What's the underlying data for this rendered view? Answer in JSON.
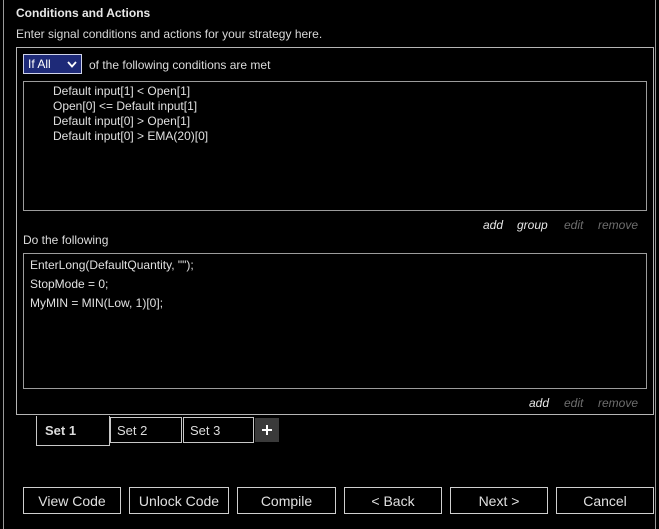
{
  "header": {
    "title": "Conditions and Actions",
    "subtitle": "Enter signal conditions and actions for your strategy here."
  },
  "conditions": {
    "mode_selected": "If All",
    "mode_suffix": "of the following conditions are met",
    "lines": [
      "Default input[1] < Open[1]",
      "Open[0] <= Default input[1]",
      "Default input[0] > Open[1]",
      "Default input[0] > EMA(20)[0]"
    ],
    "links": {
      "add": "add",
      "group": "group",
      "edit": "edit",
      "remove": "remove"
    }
  },
  "actions": {
    "label": "Do the following",
    "lines": [
      "EnterLong(DefaultQuantity, \"\");",
      "StopMode = 0;",
      "MyMIN = MIN(Low, 1)[0];"
    ],
    "links": {
      "add": "add",
      "edit": "edit",
      "remove": "remove"
    }
  },
  "sets": {
    "tabs": [
      "Set 1",
      "Set 2",
      "Set 3"
    ],
    "active": "Set 1",
    "add_icon": "plus-icon"
  },
  "footer": {
    "view_code": "View Code",
    "unlock_code": "Unlock Code",
    "compile": "Compile",
    "back": "< Back",
    "next": "Next >",
    "cancel": "Cancel"
  },
  "colors": {
    "background": "#000000",
    "dropdown_bg": "#1e2a78",
    "text": "#dcdcdc",
    "disabled_link": "#6e6e6e"
  }
}
